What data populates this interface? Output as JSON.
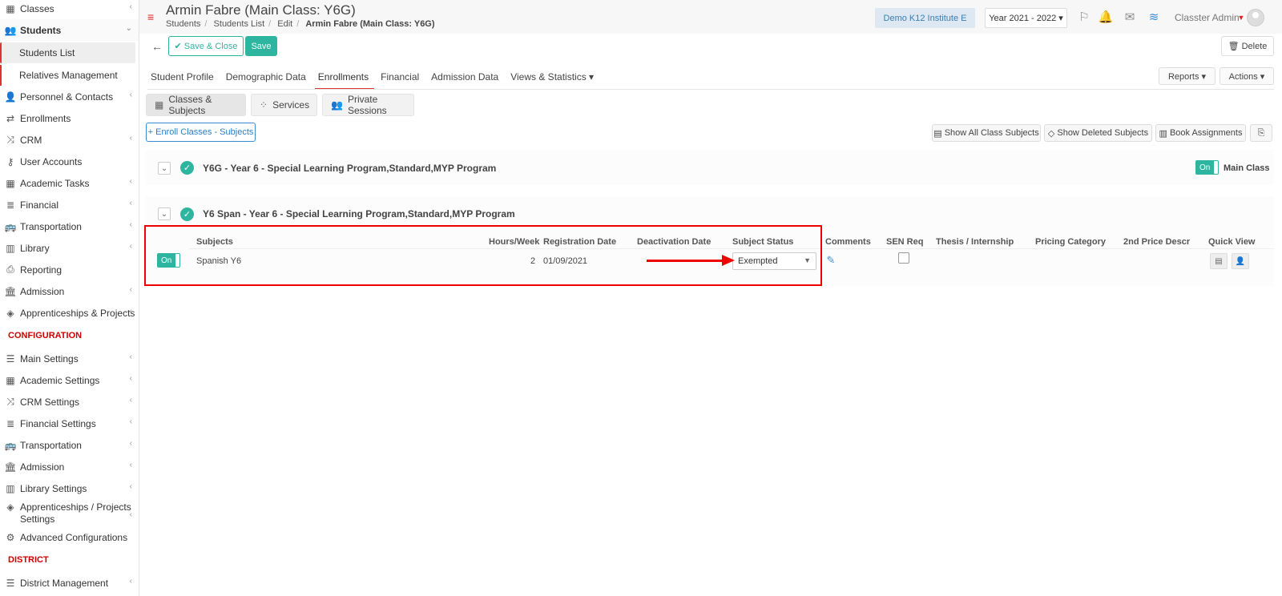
{
  "sidebar": {
    "items": [
      {
        "label": "Classes",
        "icon": "classes-icon",
        "glyph": "▦",
        "chev": "‹"
      },
      {
        "label": "Students",
        "icon": "students-icon",
        "glyph": "👥",
        "chev": "⌄"
      },
      {
        "label": "Personnel & Contacts",
        "icon": "personnel-icon",
        "glyph": "👤",
        "chev": "‹"
      },
      {
        "label": "Enrollments",
        "icon": "enrollments-icon",
        "glyph": "⇄",
        "chev": ""
      },
      {
        "label": "CRM",
        "icon": "crm-icon",
        "glyph": "⤨",
        "chev": "‹"
      },
      {
        "label": "User Accounts",
        "icon": "key-icon",
        "glyph": "⚷",
        "chev": ""
      },
      {
        "label": "Academic Tasks",
        "icon": "tasks-icon",
        "glyph": "▦",
        "chev": "‹"
      },
      {
        "label": "Financial",
        "icon": "financial-icon",
        "glyph": "≣",
        "chev": "‹"
      },
      {
        "label": "Transportation",
        "icon": "bus-icon",
        "glyph": "🚌",
        "chev": "‹"
      },
      {
        "label": "Library",
        "icon": "library-icon",
        "glyph": "▥",
        "chev": "‹"
      },
      {
        "label": "Reporting",
        "icon": "printer-icon",
        "glyph": "⎙",
        "chev": ""
      },
      {
        "label": "Admission",
        "icon": "admission-icon",
        "glyph": "🏛",
        "chev": "‹"
      },
      {
        "label": "Apprenticeships & Projects",
        "icon": "box-icon",
        "glyph": "◈",
        "chev": "‹"
      }
    ],
    "sub_items": [
      "Students List",
      "Relatives Management"
    ],
    "config_section": "CONFIGURATION",
    "config_items": [
      {
        "label": "Main Settings",
        "icon": "sliders-icon",
        "glyph": "☰",
        "chev": "‹"
      },
      {
        "label": "Academic Settings",
        "icon": "academic-settings-icon",
        "glyph": "▦",
        "chev": "‹"
      },
      {
        "label": "CRM Settings",
        "icon": "crm-settings-icon",
        "glyph": "⤨",
        "chev": "‹"
      },
      {
        "label": "Financial Settings",
        "icon": "financial-settings-icon",
        "glyph": "≣",
        "chev": "‹"
      },
      {
        "label": "Transportation",
        "icon": "bus-icon",
        "glyph": "🚌",
        "chev": "‹"
      },
      {
        "label": "Admission",
        "icon": "admission-icon",
        "glyph": "🏛",
        "chev": "‹"
      },
      {
        "label": "Library Settings",
        "icon": "library-icon",
        "glyph": "▥",
        "chev": "‹"
      },
      {
        "label": "Apprenticeships / Projects Settings",
        "icon": "box-icon",
        "glyph": "◈",
        "chev": "‹"
      },
      {
        "label": "Advanced Configurations",
        "icon": "gears-icon",
        "glyph": "⚙",
        "chev": ""
      }
    ],
    "district_section": "DISTRICT",
    "district_items": [
      {
        "label": "District Management",
        "icon": "list-icon",
        "glyph": "☰",
        "chev": "‹"
      }
    ]
  },
  "header": {
    "title": "Armin Fabre (Main Class: Y6G)",
    "breadcrumbs": [
      "Students",
      "Students List",
      "Edit",
      "Armin Fabre (Main Class: Y6G)"
    ],
    "institute": "Demo K12 Institute E",
    "year": "Year 2021 - 2022 ▾",
    "user": "Classter Admin"
  },
  "toolbar": {
    "save_close": "✔ Save & Close",
    "save": "Save",
    "delete": "🗑 Delete",
    "reports": "Reports ▾",
    "actions": "Actions ▾"
  },
  "tabs": [
    "Student Profile",
    "Demographic Data",
    "Enrollments",
    "Financial",
    "Admission Data",
    "Views & Statistics ▾"
  ],
  "subtabs": [
    "Classes & Subjects",
    "Services",
    "Private Sessions"
  ],
  "enroll_btn": "+ Enroll Classes - Subjects",
  "tools": [
    "Show All Class Subjects",
    "Show Deleted Subjects",
    "Book Assignments"
  ],
  "class1": {
    "title": "Y6G - Year 6 - Special Learning Program,Standard,MYP Program",
    "switch": "On",
    "main_class": "Main Class"
  },
  "class2": {
    "title": "Y6 Span - Year 6 - Special Learning Program,Standard,MYP Program"
  },
  "table": {
    "headers": [
      "Subjects",
      "Hours/Week",
      "Registration Date",
      "Deactivation Date",
      "Subject Status",
      "Comments",
      "SEN Req",
      "Thesis / Internship",
      "Pricing Category",
      "2nd Price Descr",
      "Quick View"
    ],
    "row": {
      "switch": "On",
      "subject": "Spanish Y6",
      "hours": "2",
      "registration": "01/09/2021",
      "deactivation": "",
      "status": "Exempted"
    }
  },
  "colors": {
    "accent": "#2db59f",
    "danger": "#dd2222",
    "link": "#3b8ccf"
  }
}
